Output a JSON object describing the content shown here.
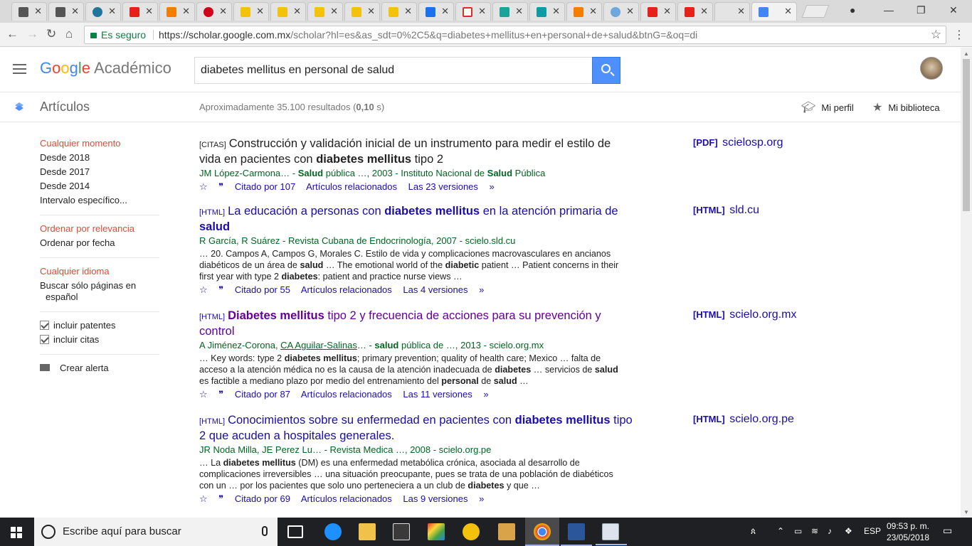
{
  "browser": {
    "tab_close": "✕",
    "omnibox": {
      "secure_label": "Es seguro",
      "url_host": "https://scholar.google.com.mx",
      "url_path": "/scholar?hl=es&as_sdt=0%2C5&q=diabetes+mellitus+en+personal+de+salud&btnG=&oq=di"
    }
  },
  "header": {
    "logo_google": [
      "G",
      "o",
      "o",
      "g",
      "l",
      "e"
    ],
    "logo_product": "Académico",
    "search_value": "diabetes mellitus en personal de salud"
  },
  "subheader": {
    "section": "Artículos",
    "results_prefix": "Aproximadamente 35.100 resultados (",
    "results_time": "0,10",
    "results_suffix": " s)",
    "my_profile": "Mi perfil",
    "my_library": "Mi biblioteca"
  },
  "sidebar": {
    "time": [
      "Cualquier momento",
      "Desde 2018",
      "Desde 2017",
      "Desde 2014",
      "Intervalo específico..."
    ],
    "sort": [
      "Ordenar por relevancia",
      "Ordenar por fecha"
    ],
    "lang": [
      "Cualquier idioma",
      "Buscar sólo páginas en",
      "español"
    ],
    "include_patents": "incluir patentes",
    "include_citations": "incluir citas",
    "create_alert": "Crear alerta"
  },
  "results": [
    {
      "tag": "[CITAS]",
      "title_parts": [
        "Construcción y validación inicial de un instrumento para medir el estilo de vida en pacientes con ",
        "diabetes mellitus",
        " tipo 2"
      ],
      "meta_parts": [
        "JM López-Carmona… - ",
        "Salud",
        " pública …, 2003 - Instituto Nacional de ",
        "Salud",
        " Pública"
      ],
      "snippet": "",
      "cited": "Citado por 107",
      "related": "Artículos relacionados",
      "versions": "Las 23 versiones",
      "side_tag": "[PDF]",
      "side_domain": "scielosp.org"
    },
    {
      "tag": "[HTML]",
      "title_parts": [
        "La educación a personas con ",
        "diabetes mellitus",
        " en la atención primaria de ",
        "salud"
      ],
      "meta": "R García, R Suárez - Revista Cubana de Endocrinología, 2007 - scielo.sld.cu",
      "snippet_parts": [
        "… 20. Campos A, Campos G, Morales C. Estilo de vida y complicaciones macrovasculares en ancianos diabéticos de un área de ",
        "salud",
        " … The emotional world of the ",
        "diabetic",
        " patient … Patient concerns in their first year with type 2 ",
        "diabetes",
        ": patient and practice nurse views …"
      ],
      "cited": "Citado por 55",
      "related": "Artículos relacionados",
      "versions": "Las 4 versiones",
      "side_tag": "[HTML]",
      "side_domain": "sld.cu"
    },
    {
      "tag": "[HTML]",
      "title_parts": [
        "Diabetes mellitus",
        " tipo 2 y frecuencia de acciones para su prevención y control"
      ],
      "meta_parts": [
        "A Jiménez-Corona, ",
        "CA Aguilar-Salinas",
        "… - ",
        "salud",
        " pública de …, 2013 - scielo.org.mx"
      ],
      "snippet_parts": [
        "… Key words: type 2 ",
        "diabetes mellitus",
        "; primary prevention; quality of health care; Mexico … falta de acceso a la atención médica no es la causa de la atención inadecuada de ",
        "diabetes",
        " … servicios de ",
        "salud",
        " es factible a mediano plazo por medio del entrenamiento del ",
        "personal",
        " de ",
        "salud",
        " …"
      ],
      "cited": "Citado por 87",
      "related": "Artículos relacionados",
      "versions": "Las 11 versiones",
      "side_tag": "[HTML]",
      "side_domain": "scielo.org.mx"
    },
    {
      "tag": "[HTML]",
      "title_parts": [
        "Conocimientos sobre su enfermedad en pacientes con ",
        "diabetes mellitus",
        " tipo 2 que acuden a hospitales generales."
      ],
      "meta": "JR Noda Milla, JE Perez Lu… - Revista Medica …, 2008 - scielo.org.pe",
      "snippet_parts": [
        "… La ",
        "diabetes mellitus",
        " (DM) es una enfermedad metabólica crónica, asociada al desarrollo de complicaciones irreversibles … una situación preocupante, pues se trata de una población de diabéticos con un … por los pacientes que solo uno perteneciera a un club de ",
        "diabetes",
        " y que …"
      ],
      "cited": "Citado por 69",
      "related": "Artículos relacionados",
      "versions": "Las 9 versiones",
      "side_tag": "[HTML]",
      "side_domain": "scielo.org.pe"
    }
  ],
  "taskbar": {
    "search_placeholder": "Escribe aquí para buscar",
    "lang": "ESP",
    "time": "09:53 p. m.",
    "date": "23/05/2018"
  },
  "colors": {
    "link": "#1a0dab",
    "visited": "#660099",
    "meta_green": "#006621",
    "accent_red": "#dd4b39",
    "search_blue": "#4d90fe"
  }
}
